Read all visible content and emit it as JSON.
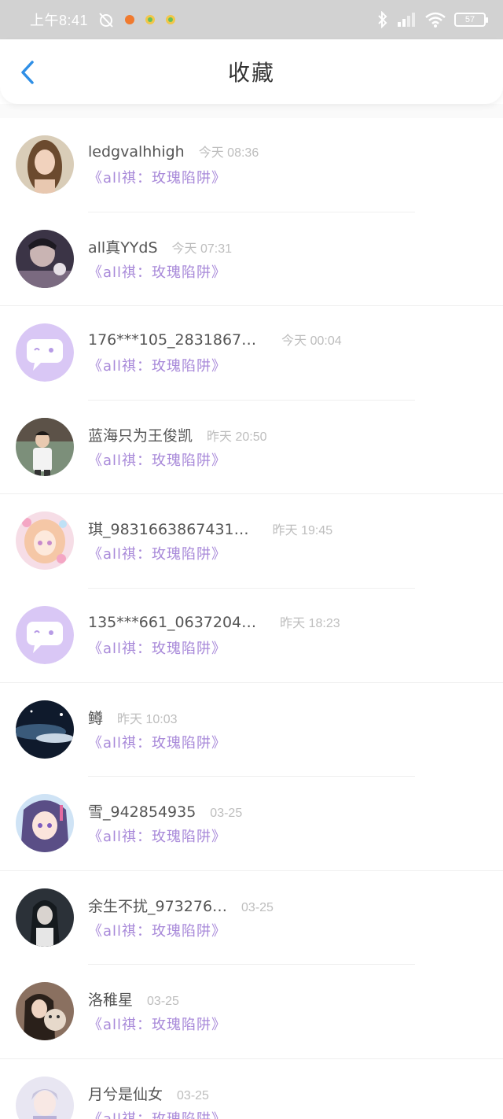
{
  "status_bar": {
    "time": "上午8:41",
    "battery": "57"
  },
  "header": {
    "title": "收藏"
  },
  "colors": {
    "accent_purple": "#a889d9",
    "back_blue": "#2f8fe6"
  },
  "items": [
    {
      "name": "ledgvalhhigh",
      "time": "今天 08:36",
      "subtitle": "《all祺：玫瑰陷阱》",
      "avatar": "photo-girl-brown-hair"
    },
    {
      "name": "all真YYdS",
      "time": "今天 07:31",
      "subtitle": "《all祺：玫瑰陷阱》",
      "avatar": "photo-boy-dark"
    },
    {
      "name": "176***105_2831867…",
      "time": "今天 00:04",
      "subtitle": "《all祺：玫瑰陷阱》",
      "avatar": "default-chat-bubble-icon"
    },
    {
      "name": "蓝海只为王俊凯",
      "time": "昨天 20:50",
      "subtitle": "《all祺：玫瑰陷阱》",
      "avatar": "photo-boy-street"
    },
    {
      "name": "琪_9831663867431…",
      "time": "昨天 19:45",
      "subtitle": "《all祺：玫瑰陷阱》",
      "avatar": "anime-pink-girl"
    },
    {
      "name": "135***661_0637204…",
      "time": "昨天 18:23",
      "subtitle": "《all祺：玫瑰陷阱》",
      "avatar": "default-chat-bubble-icon"
    },
    {
      "name": "鳟",
      "time": "昨天 10:03",
      "subtitle": "《all祺：玫瑰陷阱》",
      "avatar": "night-sky"
    },
    {
      "name": "雪_942854935",
      "time": "03-25",
      "subtitle": "《all祺：玫瑰陷阱》",
      "avatar": "anime-purple-girl"
    },
    {
      "name": "余生不扰_973276…",
      "time": "03-25",
      "subtitle": "《all祺：玫瑰陷阱》",
      "avatar": "dark-girl"
    },
    {
      "name": "洛稚星",
      "time": "03-25",
      "subtitle": "《all祺：玫瑰陷阱》",
      "avatar": "girl-with-bear"
    },
    {
      "name": "月兮是仙女",
      "time": "03-25",
      "subtitle": "《all祺：玫瑰陷阱》",
      "avatar": "anime-light-girl"
    }
  ]
}
